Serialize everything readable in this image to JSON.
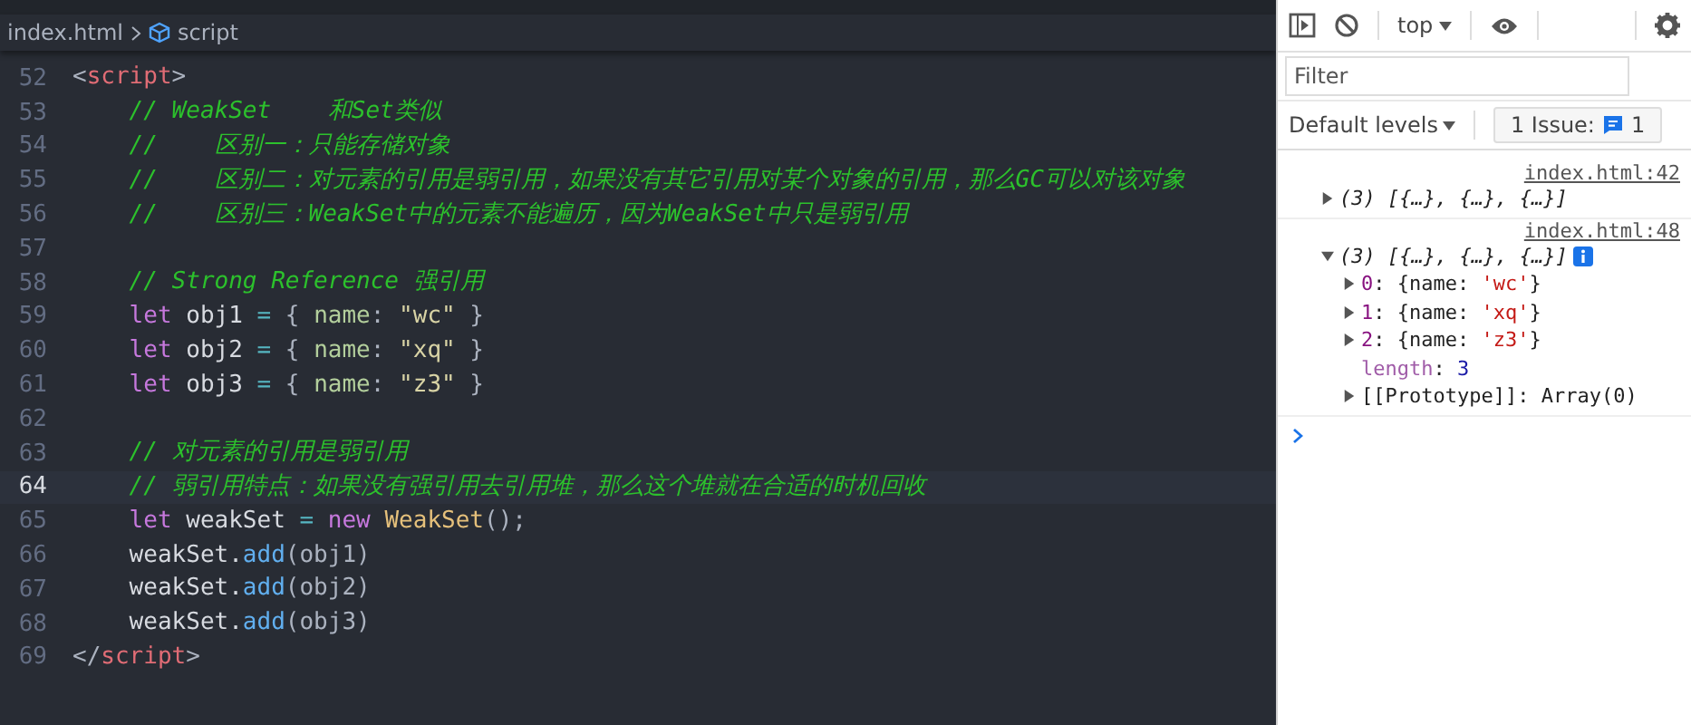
{
  "breadcrumb": {
    "file": "index.html",
    "symbol": "script"
  },
  "editor": {
    "lines": [
      {
        "number": "52",
        "current": false,
        "tokens": [
          {
            "kind": "punct",
            "text": "<"
          },
          {
            "kind": "tag",
            "text": "script"
          },
          {
            "kind": "punct",
            "text": ">"
          }
        ]
      },
      {
        "number": "53",
        "current": false,
        "tokens": [
          {
            "kind": "comment",
            "text": "    // WeakSet    和Set类似"
          }
        ]
      },
      {
        "number": "54",
        "current": false,
        "tokens": [
          {
            "kind": "comment",
            "text": "    //    区别一：只能存储对象"
          }
        ]
      },
      {
        "number": "55",
        "current": false,
        "tokens": [
          {
            "kind": "comment",
            "text": "    //    区别二：对元素的引用是弱引用，如果没有其它引用对某个对象的引用，那么GC可以对该对象"
          }
        ]
      },
      {
        "number": "56",
        "current": false,
        "tokens": [
          {
            "kind": "comment",
            "text": "    //    区别三：WeakSet中的元素不能遍历，因为WeakSet中只是弱引用"
          }
        ]
      },
      {
        "number": "57",
        "current": false
      },
      {
        "number": "58",
        "current": false,
        "tokens": [
          {
            "kind": "comment",
            "text": "    // Strong Reference 强引用"
          }
        ]
      },
      {
        "number": "59",
        "current": false,
        "tokens": [
          {
            "kind": "keyword",
            "text": "    let"
          },
          {
            "kind": "ident",
            "text": " obj1 "
          },
          {
            "kind": "operator",
            "text": "="
          },
          {
            "kind": "punct",
            "text": " { "
          },
          {
            "kind": "prop",
            "text": "name"
          },
          {
            "kind": "punct",
            "text": ": "
          },
          {
            "kind": "string",
            "text": "\"wc\""
          },
          {
            "kind": "punct",
            "text": " }"
          }
        ]
      },
      {
        "number": "60",
        "current": false,
        "tokens": [
          {
            "kind": "keyword",
            "text": "    let"
          },
          {
            "kind": "ident",
            "text": " obj2 "
          },
          {
            "kind": "operator",
            "text": "="
          },
          {
            "kind": "punct",
            "text": " { "
          },
          {
            "kind": "prop",
            "text": "name"
          },
          {
            "kind": "punct",
            "text": ": "
          },
          {
            "kind": "string",
            "text": "\"xq\""
          },
          {
            "kind": "punct",
            "text": " }"
          }
        ]
      },
      {
        "number": "61",
        "current": false,
        "tokens": [
          {
            "kind": "keyword",
            "text": "    let"
          },
          {
            "kind": "ident",
            "text": " obj3 "
          },
          {
            "kind": "operator",
            "text": "="
          },
          {
            "kind": "punct",
            "text": " { "
          },
          {
            "kind": "prop",
            "text": "name"
          },
          {
            "kind": "punct",
            "text": ": "
          },
          {
            "kind": "string",
            "text": "\"z3\""
          },
          {
            "kind": "punct",
            "text": " }"
          }
        ]
      },
      {
        "number": "62",
        "current": false
      },
      {
        "number": "63",
        "current": false,
        "tokens": [
          {
            "kind": "comment",
            "text": "    // 对元素的引用是弱引用"
          }
        ]
      },
      {
        "number": "64",
        "current": true,
        "tokens": [
          {
            "kind": "comment",
            "text": "    // 弱引用特点：如果没有强引用去引用堆，那么这个堆就在合适的时机回收"
          }
        ]
      },
      {
        "number": "65",
        "current": false,
        "tokens": [
          {
            "kind": "keyword",
            "text": "    let"
          },
          {
            "kind": "ident",
            "text": " weakSet "
          },
          {
            "kind": "operator",
            "text": "="
          },
          {
            "kind": "keyword",
            "text": " new "
          },
          {
            "kind": "class",
            "text": "WeakSet"
          },
          {
            "kind": "punct",
            "text": "();"
          }
        ]
      },
      {
        "number": "66",
        "current": false,
        "tokens": [
          {
            "kind": "ident",
            "text": "    weakSet."
          },
          {
            "kind": "method",
            "text": "add"
          },
          {
            "kind": "punct",
            "text": "(obj1)"
          }
        ]
      },
      {
        "number": "67",
        "current": false,
        "tokens": [
          {
            "kind": "ident",
            "text": "    weakSet."
          },
          {
            "kind": "method",
            "text": "add"
          },
          {
            "kind": "punct",
            "text": "(obj2)"
          }
        ]
      },
      {
        "number": "68",
        "current": false,
        "tokens": [
          {
            "kind": "ident",
            "text": "    weakSet."
          },
          {
            "kind": "method",
            "text": "add"
          },
          {
            "kind": "punct",
            "text": "(obj3)"
          }
        ]
      },
      {
        "number": "69",
        "current": false,
        "tokens": [
          {
            "kind": "punct",
            "text": "</"
          },
          {
            "kind": "tag",
            "text": "script"
          },
          {
            "kind": "punct",
            "text": ">"
          }
        ]
      }
    ]
  },
  "devtools": {
    "context": "top",
    "filter": {
      "placeholder": "Filter"
    },
    "levels": "Default levels",
    "issues": {
      "label": "1 Issue:",
      "count": "1"
    },
    "console": [
      {
        "source": "index.html:42",
        "summary": "(3) [{…}, {…}, {…}]",
        "expanded": false
      },
      {
        "source": "index.html:48",
        "summary": "(3) [{…}, {…}, {…}]",
        "expanded": true,
        "children": [
          {
            "kind": "object",
            "tokens": [
              {
                "kind": "key",
                "text": "0"
              },
              {
                "kind": "plain",
                "text": ": {name: "
              },
              {
                "kind": "string",
                "text": "'wc'"
              },
              {
                "kind": "plain",
                "text": "}"
              }
            ]
          },
          {
            "kind": "object",
            "tokens": [
              {
                "kind": "key",
                "text": "1"
              },
              {
                "kind": "plain",
                "text": ": {name: "
              },
              {
                "kind": "string",
                "text": "'xq'"
              },
              {
                "kind": "plain",
                "text": "}"
              }
            ]
          },
          {
            "kind": "object",
            "tokens": [
              {
                "kind": "key",
                "text": "2"
              },
              {
                "kind": "plain",
                "text": ": {name: "
              },
              {
                "kind": "string",
                "text": "'z3'"
              },
              {
                "kind": "plain",
                "text": "}"
              }
            ]
          },
          {
            "kind": "property",
            "tokens": [
              {
                "kind": "dimkey",
                "text": "length"
              },
              {
                "kind": "plain",
                "text": ": "
              },
              {
                "kind": "number",
                "text": "3"
              }
            ]
          },
          {
            "kind": "object",
            "tokens": [
              {
                "kind": "plain",
                "text": "[[Prototype]]: Array(0)"
              }
            ]
          }
        ]
      }
    ]
  }
}
